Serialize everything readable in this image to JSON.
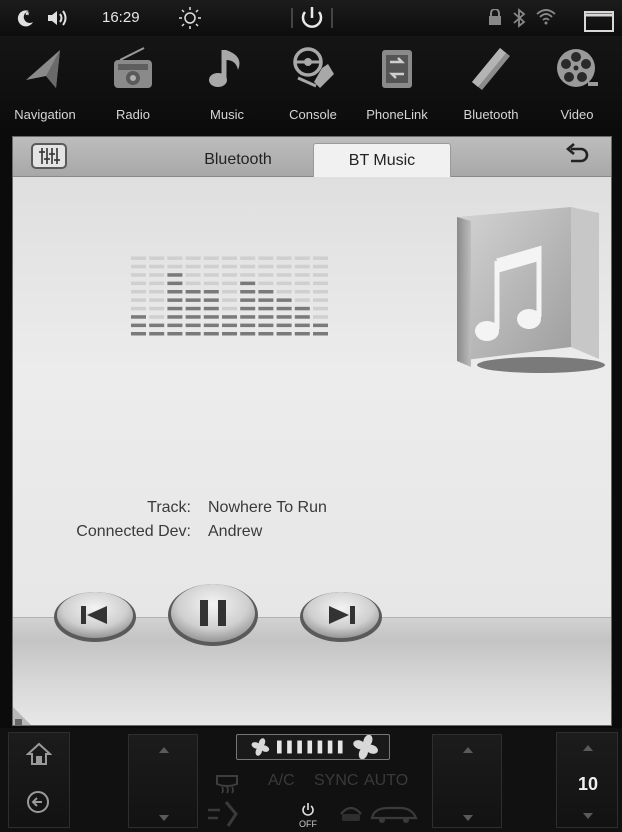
{
  "status_bar": {
    "time": "16:29",
    "icons": [
      "night-mode-icon",
      "volume-icon",
      "brightness-icon",
      "power-icon",
      "lock-icon",
      "bluetooth-status-icon",
      "wifi-icon",
      "window-icon"
    ]
  },
  "apps": [
    {
      "label": "Navigation",
      "icon": "navigation-icon"
    },
    {
      "label": "Radio",
      "icon": "radio-icon"
    },
    {
      "label": "Music",
      "icon": "music-note-icon"
    },
    {
      "label": "Console",
      "icon": "steering-wheel-icon"
    },
    {
      "label": "PhoneLink",
      "icon": "phonelink-icon"
    },
    {
      "label": "Bluetooth",
      "icon": "bluetooth-phone-icon"
    },
    {
      "label": "Video",
      "icon": "film-reel-icon"
    }
  ],
  "tabs": [
    {
      "label": "Bluetooth",
      "active": false
    },
    {
      "label": "BT Music",
      "active": true
    }
  ],
  "track": {
    "label": "Track:",
    "value": "Nowhere To Run"
  },
  "device": {
    "label": "Connected Dev:",
    "value": "Andrew"
  },
  "equalizer_levels": [
    3,
    2,
    8,
    6,
    6,
    3,
    7,
    6,
    5,
    4,
    2
  ],
  "climate": {
    "ac": "A/C",
    "sync": "SYNC",
    "auto": "AUTO",
    "power_off": "OFF",
    "temperature": "10",
    "fan_level": 7
  },
  "colors": {
    "background": "#0b0b0b",
    "panel": "#e8e8e8",
    "active_tab": "#f1f1f1"
  }
}
